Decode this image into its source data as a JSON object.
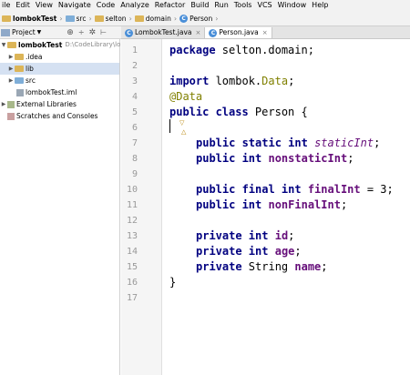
{
  "menubar": {
    "items": [
      "ile",
      "Edit",
      "View",
      "Navigate",
      "Code",
      "Analyze",
      "Refactor",
      "Build",
      "Run",
      "Tools",
      "VCS",
      "Window",
      "Help"
    ]
  },
  "navbar": {
    "crumbs": [
      "lombokTest",
      "src",
      "selton",
      "domain",
      "Person"
    ]
  },
  "sidebar": {
    "title": "Project",
    "items": [
      {
        "label": "lombokTest",
        "detail": "D:\\CodeLibrary\\lo"
      },
      {
        "label": ".idea"
      },
      {
        "label": "lib"
      },
      {
        "label": "src"
      },
      {
        "label": "lombokTest.iml"
      },
      {
        "label": "External Libraries"
      },
      {
        "label": "Scratches and Consoles"
      }
    ]
  },
  "tabs": [
    {
      "label": "LombokTest.java",
      "close": "×"
    },
    {
      "label": "Person.java",
      "close": "×"
    }
  ],
  "editor": {
    "line_numbers": [
      "1",
      "2",
      "3",
      "4",
      "5",
      "6",
      "7",
      "8",
      "9",
      "10",
      "11",
      "12",
      "13",
      "14",
      "15",
      "16",
      "17"
    ],
    "code": {
      "l1_kw": "package",
      "l1_rest": " selton.domain;",
      "l3_kw": "import",
      "l3_a": " lombok.",
      "l3_ann": "Data",
      "l3_b": ";",
      "l4_ann": "@Data",
      "l5_kw": "public class",
      "l5_rest": " Person {",
      "l7_kw": "public static int",
      "l7_field": "staticInt",
      "l7_end": ";",
      "l8_kw": "public int",
      "l8_field": "nonstaticInt",
      "l8_end": ";",
      "l10_kw": "public final int",
      "l10_field": "finalInt",
      "l10_end": " = 3;",
      "l11_kw": "public int",
      "l11_field": "nonFinalInt",
      "l11_end": ";",
      "l13_kw": "private int",
      "l13_field": "id",
      "l13_end": ";",
      "l14_kw": "private int",
      "l14_field": "age",
      "l14_end": ";",
      "l15_kw": "private",
      "l15_type": " String ",
      "l15_field": "name",
      "l15_end": ";",
      "l16": "}"
    }
  }
}
